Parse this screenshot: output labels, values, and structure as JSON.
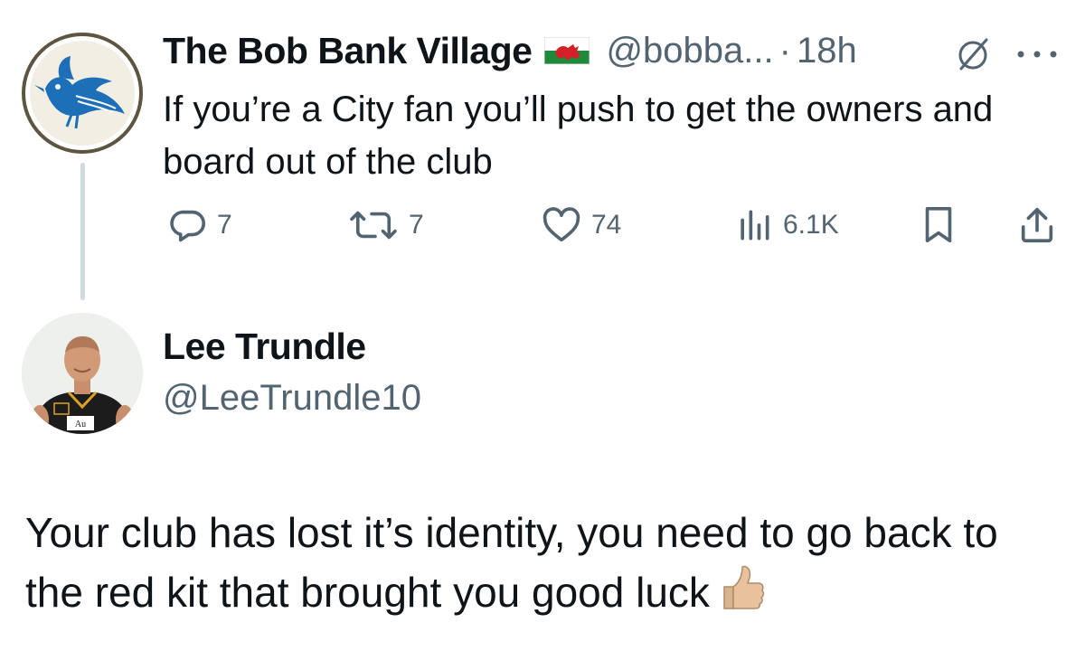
{
  "tweet": {
    "author_name": "The Bob Bank Village",
    "handle": "@bobba...",
    "separator": "·",
    "time": "18h",
    "text": "If you’re a City fan you’ll push to get the owners and board out of the club",
    "icons": {
      "flag": "wales-flag-icon",
      "badge": "circle-slash-icon",
      "more": "more-dots-icon"
    },
    "actions": {
      "replies": "7",
      "reposts": "7",
      "likes": "74",
      "views": "6.1K"
    }
  },
  "reply": {
    "author_name": "Lee Trundle",
    "handle": "@LeeTrundle10",
    "text": "Your club has lost it’s identity, you need to go back to the red kit that brought you good luck",
    "emoji": "thumbs-up-icon"
  },
  "colors": {
    "text": "#0f1419",
    "secondary": "#536471",
    "thread_line": "#cfd9de",
    "bird_blue": "#1d6fb8"
  }
}
